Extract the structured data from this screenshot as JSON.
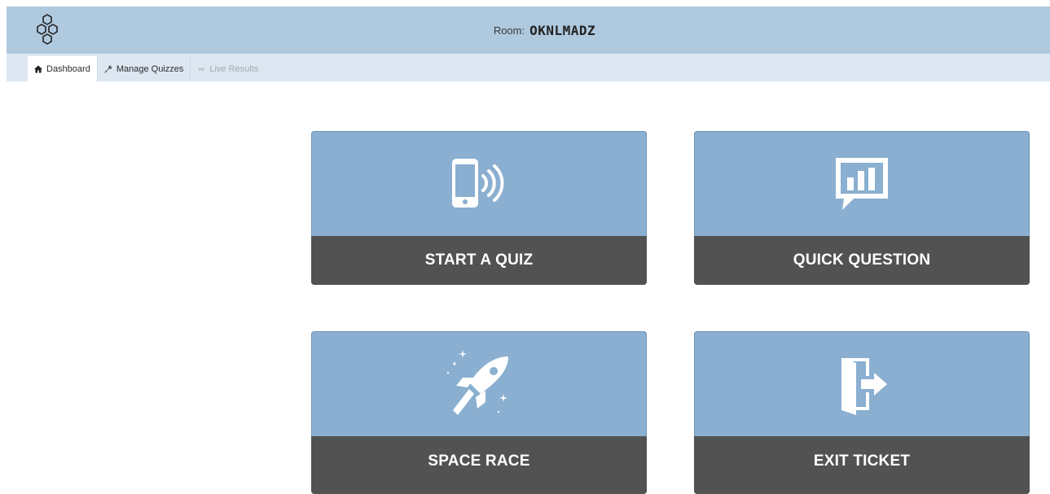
{
  "header": {
    "logo_icon": "hexagon-cluster-logo-icon",
    "room_label": "Room:",
    "room_code": "OKNLMADZ"
  },
  "nav": {
    "tabs": [
      {
        "label": "Dashboard",
        "icon": "home-icon",
        "state": "active"
      },
      {
        "label": "Manage Quizzes",
        "icon": "wrench-icon",
        "state": "normal"
      },
      {
        "label": "Live Results",
        "icon": "signal-icon",
        "state": "disabled"
      }
    ]
  },
  "tiles": [
    {
      "label": "START A QUIZ",
      "icon": "phone-signal-icon"
    },
    {
      "label": "QUICK QUESTION",
      "icon": "chat-bar-chart-icon"
    },
    {
      "label": "SPACE RACE",
      "icon": "rocket-icon"
    },
    {
      "label": "EXIT TICKET",
      "icon": "exit-door-icon"
    }
  ],
  "colors": {
    "header_bg": "#afc9df",
    "nav_bg": "#dde7f1",
    "tile_top": "#8aafd0",
    "tile_bottom": "#525252"
  }
}
